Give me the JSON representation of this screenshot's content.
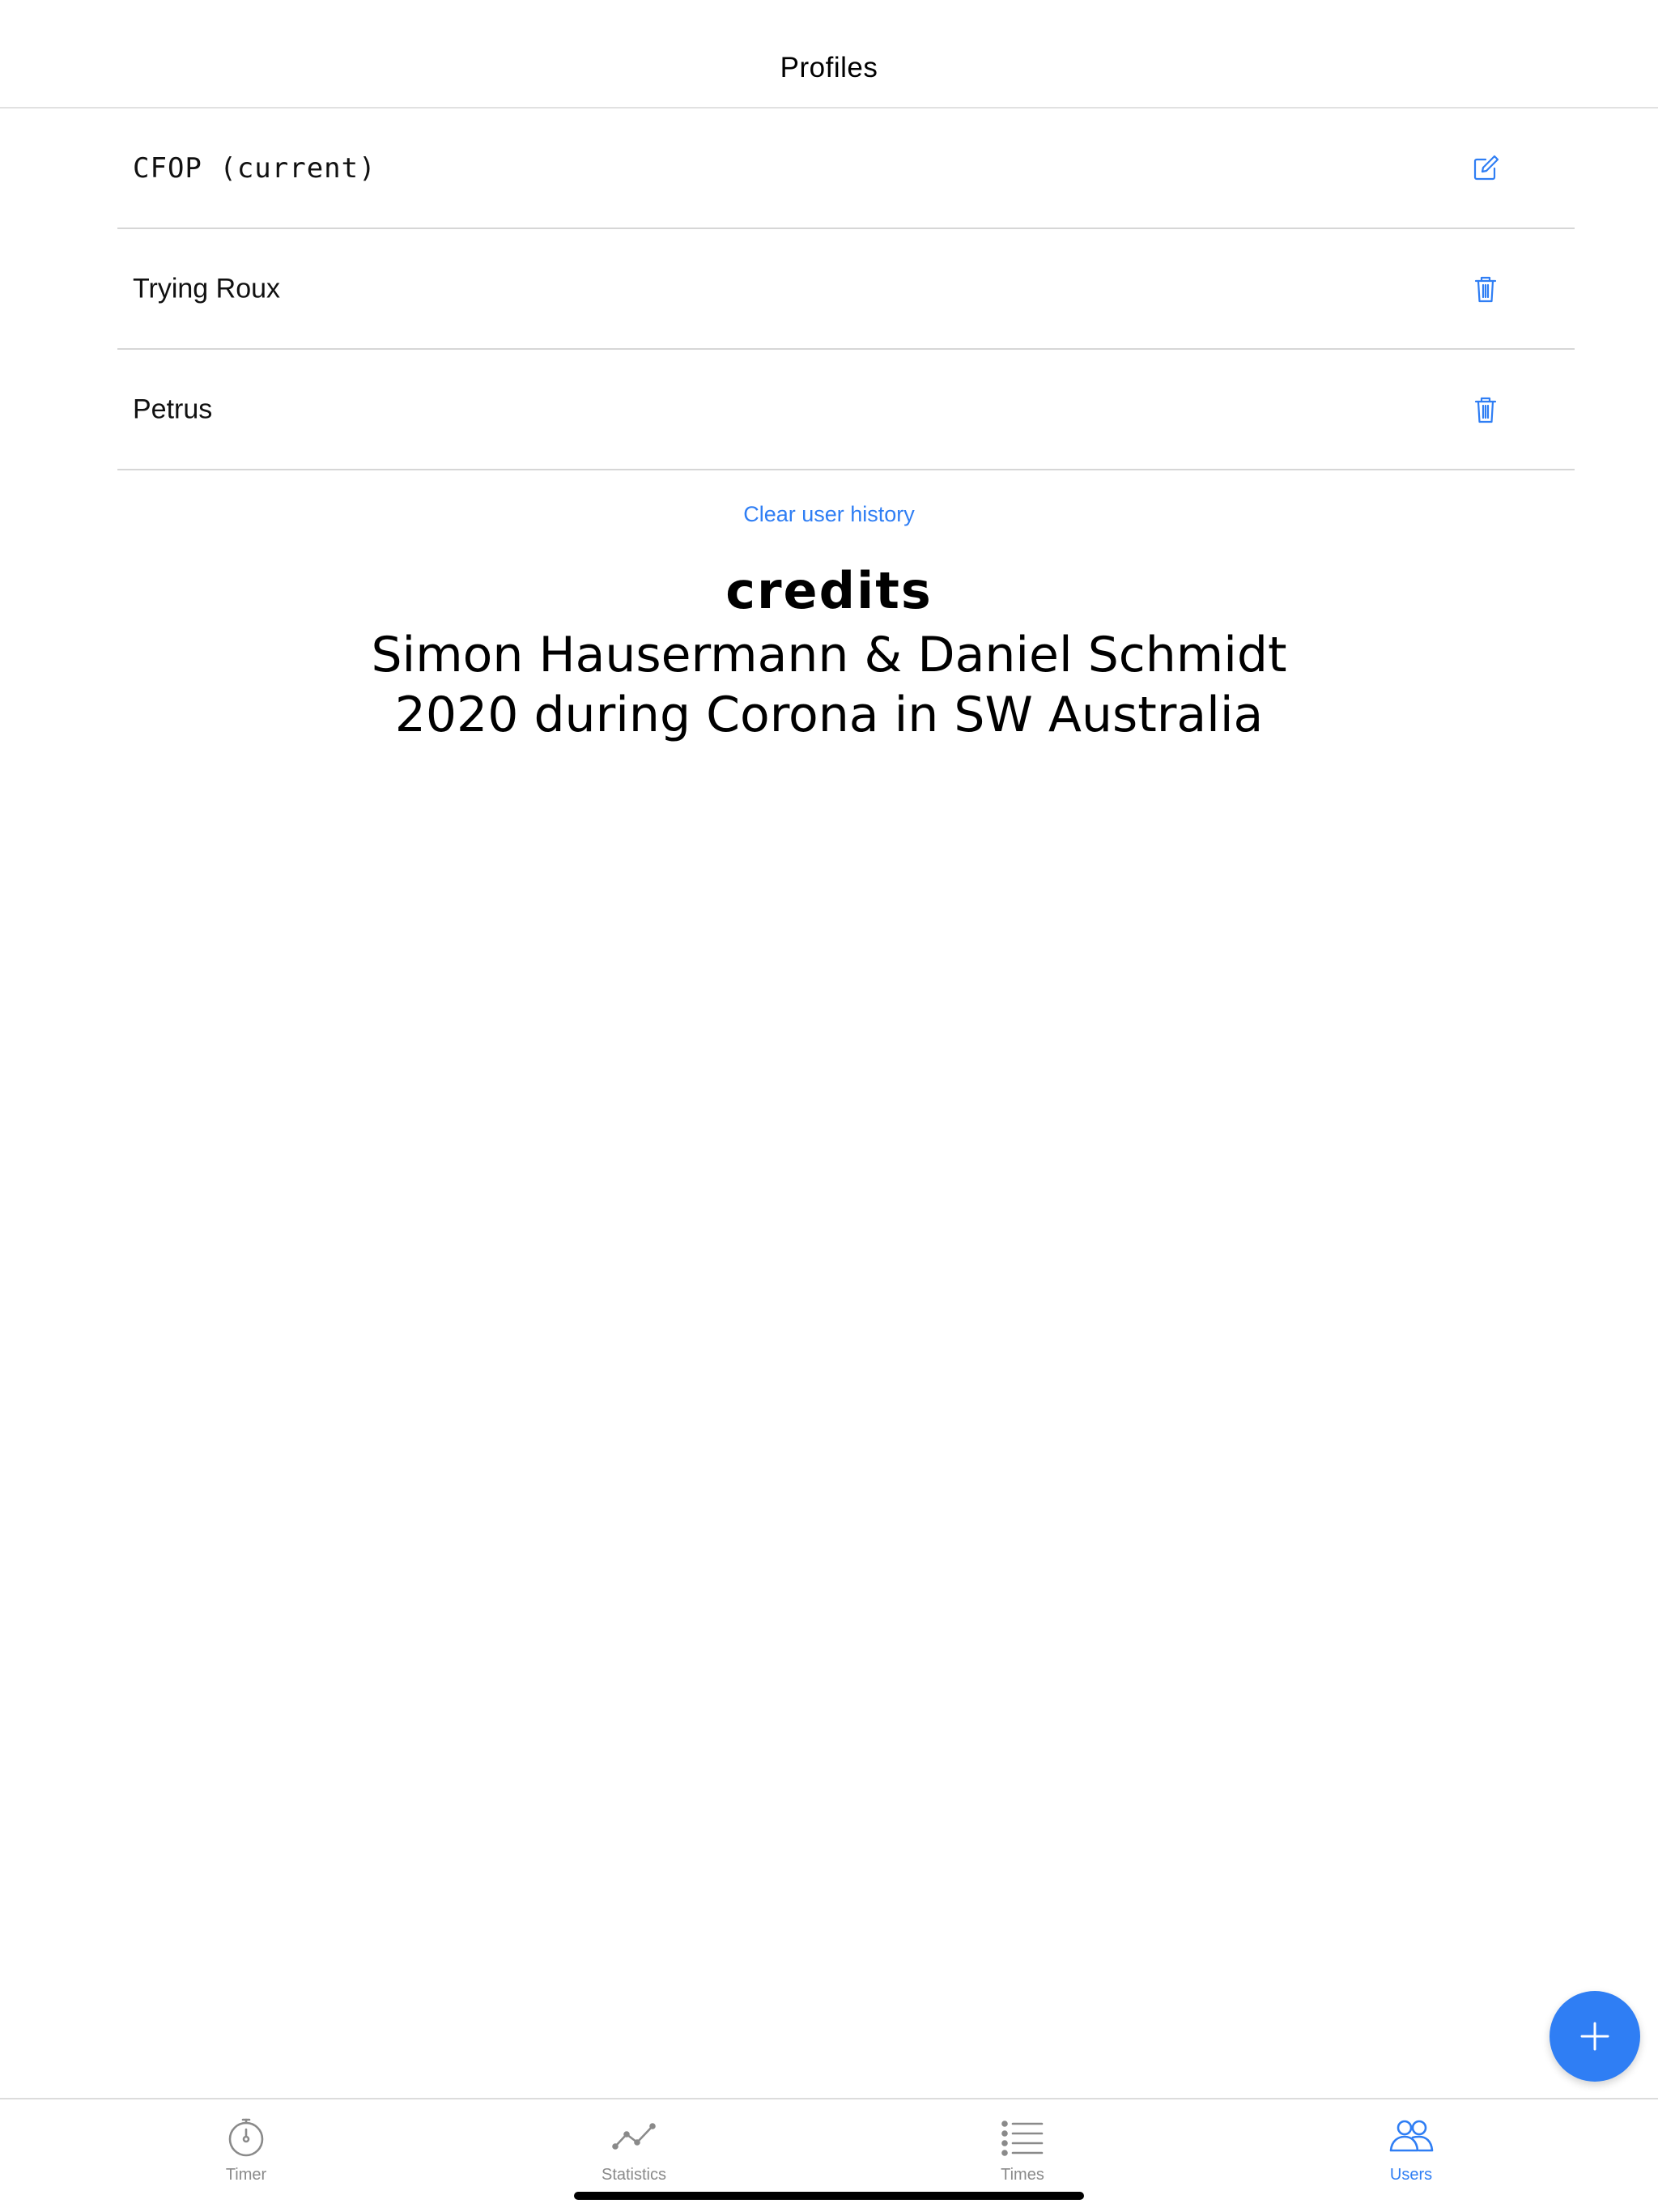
{
  "header": {
    "title": "Profiles"
  },
  "profiles": [
    {
      "name": "CFOP (current)",
      "action": "edit-icon"
    },
    {
      "name": "Trying Roux",
      "action": "trash-icon"
    },
    {
      "name": "Petrus",
      "action": "trash-icon"
    }
  ],
  "clear_history_label": "Clear user history",
  "credits": {
    "title": "credits",
    "line1": "Simon Hausermann & Daniel Schmidt",
    "line2": "2020 during Corona in SW Australia"
  },
  "fab": {
    "icon": "plus-icon"
  },
  "tabs": [
    {
      "label": "Timer",
      "icon": "stopwatch-icon",
      "active": false
    },
    {
      "label": "Statistics",
      "icon": "chart-line-icon",
      "active": false
    },
    {
      "label": "Times",
      "icon": "list-icon",
      "active": false
    },
    {
      "label": "Users",
      "icon": "users-icon",
      "active": true
    }
  ],
  "colors": {
    "accent": "#2f7ef4",
    "inactive_tab": "#8a8a8a",
    "divider": "#d6d6d6"
  }
}
